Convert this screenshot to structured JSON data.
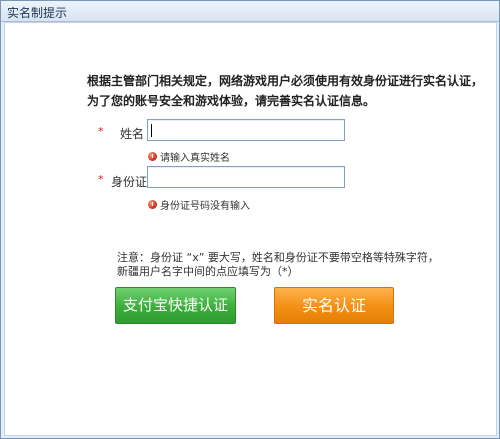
{
  "window": {
    "title": "实名制提示"
  },
  "notice": {
    "line1": "根据主管部门相关规定，网络游戏用户必须使用有效身份证进行实名认证，",
    "line2": "为了您的账号安全和游戏体验，请完善实名认证信息。"
  },
  "form": {
    "name": {
      "required_mark": "*",
      "label": "姓名",
      "value": "",
      "hint": "请输入真实姓名"
    },
    "id_card": {
      "required_mark": "*",
      "label": "身份证",
      "value": "",
      "hint": "身份证号码没有输入"
    }
  },
  "note": {
    "line1": "注意：身份证 “x” 要大写，姓名和身份证不要带空格等特殊字符，",
    "line2": "新疆用户名字中间的点应填写为（*）"
  },
  "buttons": {
    "alipay_label": "支付宝快捷认证",
    "verify_label": "实名认证"
  },
  "colors": {
    "alipay_button": "#3cae3c",
    "verify_button": "#f28f14",
    "required_mark": "#d21f1f"
  }
}
